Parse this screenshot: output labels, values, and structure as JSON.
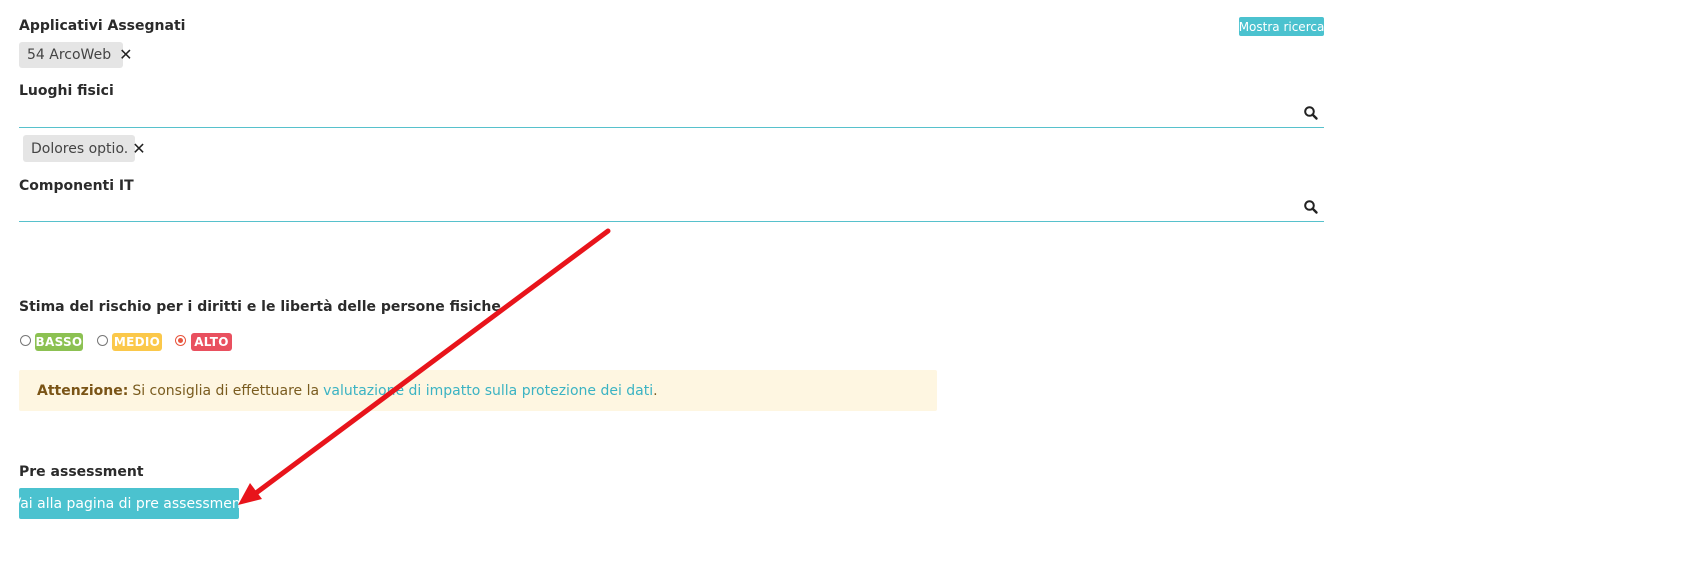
{
  "applicativi": {
    "label": "Applicativi Assegnati",
    "search_toggle_label": "Mostra ricerca",
    "tags": [
      {
        "text": "54 ArcoWeb"
      }
    ]
  },
  "luoghi": {
    "label": "Luoghi fisici",
    "input_value": "",
    "tags": [
      {
        "text": "Dolores optio."
      }
    ]
  },
  "componenti": {
    "label": "Componenti IT",
    "input_value": ""
  },
  "rischio": {
    "label": "Stima del rischio per i diritti e le libertà delle persone fisiche",
    "options": [
      {
        "label": "BASSO",
        "color": "#8cc152",
        "selected": false
      },
      {
        "label": "MEDIO",
        "color": "#fbc84a",
        "selected": false
      },
      {
        "label": "ALTO",
        "color": "#e9505f",
        "selected": true
      }
    ]
  },
  "alert": {
    "strong": "Attenzione:",
    "text": "Si consiglia di effettuare la",
    "link": "valutazione di impatto sulla protezione dei dati",
    "suffix": "."
  },
  "pre_assessment": {
    "label": "Pre assessment",
    "button_label": "Vai alla pagina di pre assessment"
  },
  "colors": {
    "accent": "#4bc2cf",
    "annotation_arrow": "#e8141b"
  },
  "icons": {
    "search": "search-icon",
    "remove": "close-icon"
  }
}
